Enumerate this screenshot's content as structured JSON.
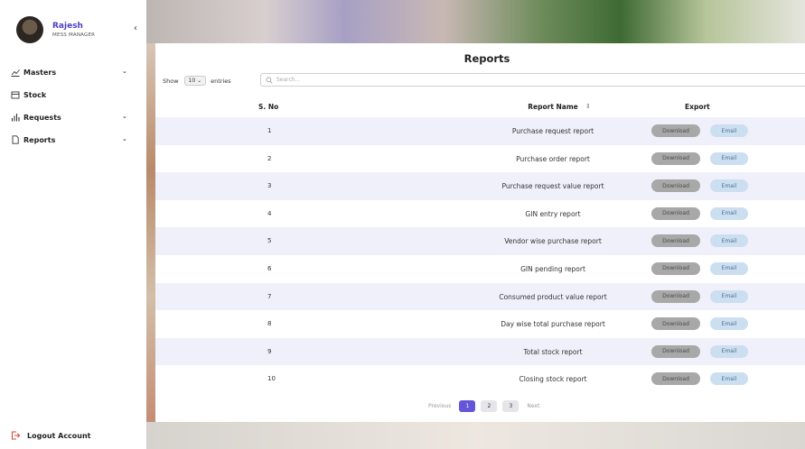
{
  "profile": {
    "name": "Rajesh",
    "role": "MESS MANAGER"
  },
  "sidebar": {
    "collapse_icon": "chevron-left-icon",
    "items": [
      {
        "label": "Masters",
        "icon": "line-chart-icon",
        "has_dropdown": true
      },
      {
        "label": "Stock",
        "icon": "box-icon",
        "has_dropdown": false
      },
      {
        "label": "Requests",
        "icon": "bar-chart-icon",
        "has_dropdown": true
      },
      {
        "label": "Reports",
        "icon": "document-icon",
        "has_dropdown": true
      }
    ],
    "logout_label": "Logout Account"
  },
  "page": {
    "title": "Reports"
  },
  "controls": {
    "show_label": "Show",
    "entries_value": "10",
    "entries_label": "entries",
    "search_placeholder": "Search..."
  },
  "table": {
    "columns": [
      "S. No",
      "Report Name",
      "Export"
    ],
    "rows": [
      {
        "sno": "1",
        "name": "Purchase request report"
      },
      {
        "sno": "2",
        "name": "Purchase order report"
      },
      {
        "sno": "3",
        "name": "Purchase request value report"
      },
      {
        "sno": "4",
        "name": "GIN entry report"
      },
      {
        "sno": "5",
        "name": "Vendor wise purchase report"
      },
      {
        "sno": "6",
        "name": "GIN pending report"
      },
      {
        "sno": "7",
        "name": "Consumed product value report"
      },
      {
        "sno": "8",
        "name": "Day wise total purchase report"
      },
      {
        "sno": "9",
        "name": "Total stock report"
      },
      {
        "sno": "10",
        "name": "Closing stock report"
      }
    ],
    "download_label": "Download",
    "email_label": "Email"
  },
  "pagination": {
    "previous": "Previous",
    "pages": [
      "1",
      "2",
      "3"
    ],
    "active": "1",
    "next": "Next"
  },
  "colors": {
    "accent": "#6556d9",
    "row_alt": "#f0f0fb",
    "download_btn": "#a8a8a8",
    "email_btn": "#cbdff0"
  }
}
